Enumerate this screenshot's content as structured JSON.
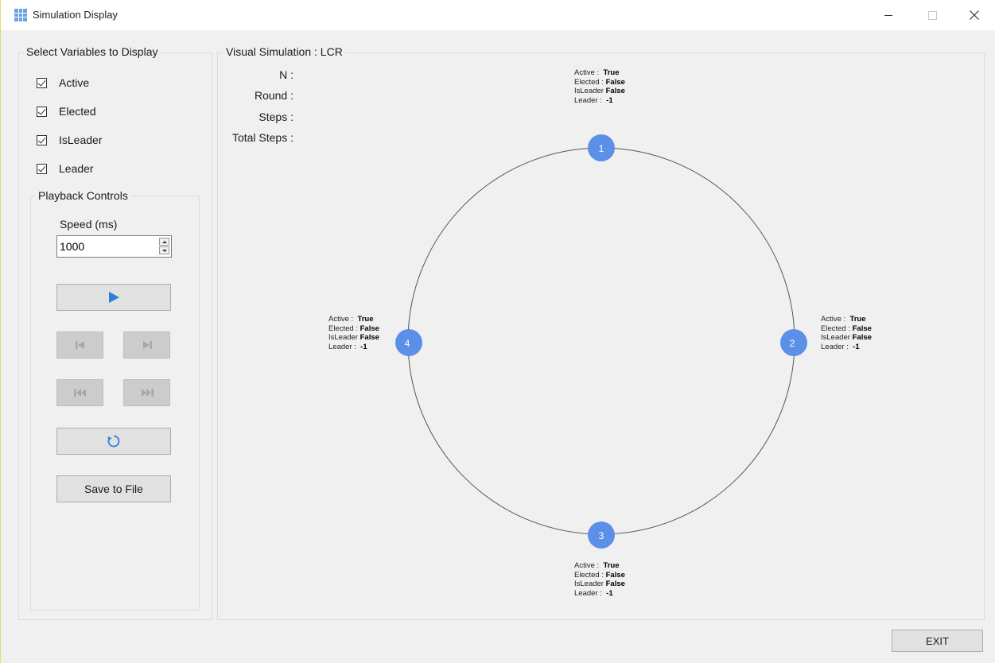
{
  "window": {
    "title": "Simulation Display"
  },
  "variables": {
    "title": "Select Variables to Display",
    "items": [
      {
        "label": "Active",
        "checked": true
      },
      {
        "label": "Elected",
        "checked": true
      },
      {
        "label": "IsLeader",
        "checked": true
      },
      {
        "label": "Leader",
        "checked": true
      }
    ]
  },
  "playback": {
    "title": "Playback Controls",
    "speed_label": "Speed (ms)",
    "speed_value": "1000",
    "play_icon": "play-icon",
    "prev_icon": "step-back-icon",
    "next_icon": "step-forward-icon",
    "first_icon": "skip-to-start-icon",
    "last_icon": "skip-to-end-icon",
    "reset_icon": "reset-icon",
    "save_label": "Save to File"
  },
  "simulation": {
    "title": "Visual Simulation : LCR",
    "stats": [
      {
        "label": "N :"
      },
      {
        "label": "Round :"
      },
      {
        "label": "Steps :"
      },
      {
        "label": "Total Steps :"
      }
    ],
    "node_color": "#5b8fe8",
    "ring_color": "#555555",
    "nodes": [
      {
        "id": "1",
        "active": "True",
        "elected": "False",
        "isleader": "False",
        "leader": "-1"
      },
      {
        "id": "2",
        "active": "True",
        "elected": "False",
        "isleader": "False",
        "leader": "-1"
      },
      {
        "id": "3",
        "active": "True",
        "elected": "False",
        "isleader": "False",
        "leader": "-1"
      },
      {
        "id": "4",
        "active": "True",
        "elected": "False",
        "isleader": "False",
        "leader": "-1"
      }
    ],
    "field_labels": {
      "active": "Active :",
      "elected": "Elected :",
      "isleader": "IsLeader",
      "leader": "Leader :"
    }
  },
  "footer": {
    "exit_label": "EXIT"
  }
}
